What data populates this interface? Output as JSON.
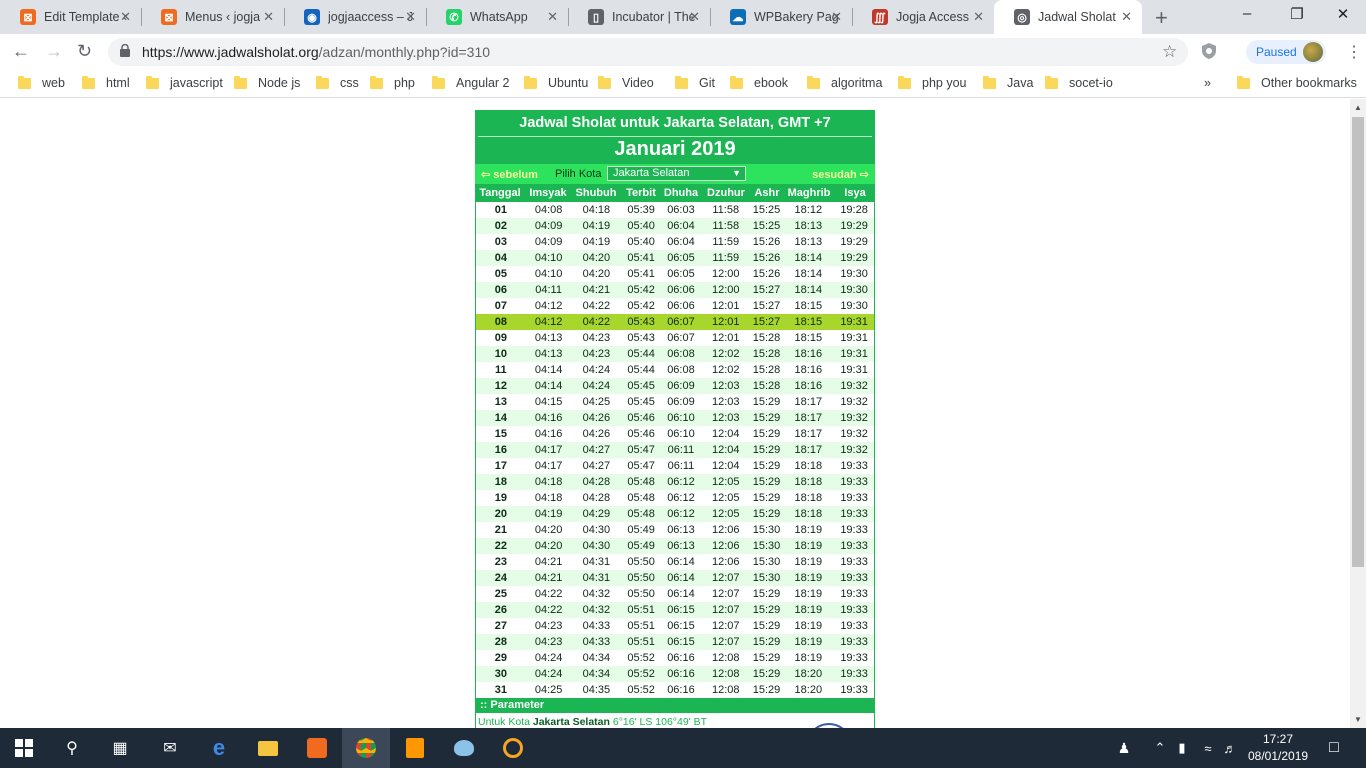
{
  "browser": {
    "tabs": [
      {
        "title": "Edit Template ‹",
        "icon": "xampp-icon",
        "color": "#f06a1f"
      },
      {
        "title": "Menus ‹ jogja",
        "icon": "xampp-icon",
        "color": "#f06a1f"
      },
      {
        "title": "jogjaaccess – J",
        "icon": "vpn-icon",
        "color": "#1565c0"
      },
      {
        "title": "WhatsApp",
        "icon": "whatsapp-icon",
        "color": "#25d366"
      },
      {
        "title": "Incubator | The",
        "icon": "document-icon",
        "color": "#5f6368"
      },
      {
        "title": "WPBakery Pag",
        "icon": "wpbakery-icon",
        "color": "#0d6eb8"
      },
      {
        "title": "Jogja Access",
        "icon": "site-icon",
        "color": "#c0392b"
      },
      {
        "title": "Jadwal Sholat",
        "icon": "globe-icon",
        "color": "#5f6368"
      }
    ],
    "url_host": "https://www.jadwalsholat.org",
    "url_path": "/adzan/monthly.php?id=310",
    "profile_label": "Paused",
    "bookmarks": [
      "web",
      "html",
      "javascript",
      "Node js",
      "css",
      "php",
      "Angular 2",
      "Ubuntu",
      "Video",
      "Git",
      "ebook",
      "algoritma",
      "php you",
      "Java",
      "socet-io"
    ],
    "overflow_label": "»",
    "other_bookmarks": "Other bookmarks"
  },
  "page": {
    "title": "Jadwal Sholat untuk Jakarta Selatan, GMT +7",
    "month": "Januari 2019",
    "prev_label": "sebelum",
    "next_label": "sesudah",
    "city_label": "Pilih Kota",
    "city_value": "Jakarta Selatan",
    "columns": [
      "Tanggal",
      "Imsyak",
      "Shubuh",
      "Terbit",
      "Dhuha",
      "Dzuhur",
      "Ashr",
      "Maghrib",
      "Isya"
    ],
    "highlight_day": "08",
    "rows": [
      [
        "01",
        "04:08",
        "04:18",
        "05:39",
        "06:03",
        "11:58",
        "15:25",
        "18:12",
        "19:28"
      ],
      [
        "02",
        "04:09",
        "04:19",
        "05:40",
        "06:04",
        "11:58",
        "15:25",
        "18:13",
        "19:29"
      ],
      [
        "03",
        "04:09",
        "04:19",
        "05:40",
        "06:04",
        "11:59",
        "15:26",
        "18:13",
        "19:29"
      ],
      [
        "04",
        "04:10",
        "04:20",
        "05:41",
        "06:05",
        "11:59",
        "15:26",
        "18:14",
        "19:29"
      ],
      [
        "05",
        "04:10",
        "04:20",
        "05:41",
        "06:05",
        "12:00",
        "15:26",
        "18:14",
        "19:30"
      ],
      [
        "06",
        "04:11",
        "04:21",
        "05:42",
        "06:06",
        "12:00",
        "15:27",
        "18:14",
        "19:30"
      ],
      [
        "07",
        "04:12",
        "04:22",
        "05:42",
        "06:06",
        "12:01",
        "15:27",
        "18:15",
        "19:30"
      ],
      [
        "08",
        "04:12",
        "04:22",
        "05:43",
        "06:07",
        "12:01",
        "15:27",
        "18:15",
        "19:31"
      ],
      [
        "09",
        "04:13",
        "04:23",
        "05:43",
        "06:07",
        "12:01",
        "15:28",
        "18:15",
        "19:31"
      ],
      [
        "10",
        "04:13",
        "04:23",
        "05:44",
        "06:08",
        "12:02",
        "15:28",
        "18:16",
        "19:31"
      ],
      [
        "11",
        "04:14",
        "04:24",
        "05:44",
        "06:08",
        "12:02",
        "15:28",
        "18:16",
        "19:31"
      ],
      [
        "12",
        "04:14",
        "04:24",
        "05:45",
        "06:09",
        "12:03",
        "15:28",
        "18:16",
        "19:32"
      ],
      [
        "13",
        "04:15",
        "04:25",
        "05:45",
        "06:09",
        "12:03",
        "15:29",
        "18:17",
        "19:32"
      ],
      [
        "14",
        "04:16",
        "04:26",
        "05:46",
        "06:10",
        "12:03",
        "15:29",
        "18:17",
        "19:32"
      ],
      [
        "15",
        "04:16",
        "04:26",
        "05:46",
        "06:10",
        "12:04",
        "15:29",
        "18:17",
        "19:32"
      ],
      [
        "16",
        "04:17",
        "04:27",
        "05:47",
        "06:11",
        "12:04",
        "15:29",
        "18:17",
        "19:32"
      ],
      [
        "17",
        "04:17",
        "04:27",
        "05:47",
        "06:11",
        "12:04",
        "15:29",
        "18:18",
        "19:33"
      ],
      [
        "18",
        "04:18",
        "04:28",
        "05:48",
        "06:12",
        "12:05",
        "15:29",
        "18:18",
        "19:33"
      ],
      [
        "19",
        "04:18",
        "04:28",
        "05:48",
        "06:12",
        "12:05",
        "15:29",
        "18:18",
        "19:33"
      ],
      [
        "20",
        "04:19",
        "04:29",
        "05:48",
        "06:12",
        "12:05",
        "15:29",
        "18:18",
        "19:33"
      ],
      [
        "21",
        "04:20",
        "04:30",
        "05:49",
        "06:13",
        "12:06",
        "15:30",
        "18:19",
        "19:33"
      ],
      [
        "22",
        "04:20",
        "04:30",
        "05:49",
        "06:13",
        "12:06",
        "15:30",
        "18:19",
        "19:33"
      ],
      [
        "23",
        "04:21",
        "04:31",
        "05:50",
        "06:14",
        "12:06",
        "15:30",
        "18:19",
        "19:33"
      ],
      [
        "24",
        "04:21",
        "04:31",
        "05:50",
        "06:14",
        "12:07",
        "15:30",
        "18:19",
        "19:33"
      ],
      [
        "25",
        "04:22",
        "04:32",
        "05:50",
        "06:14",
        "12:07",
        "15:29",
        "18:19",
        "19:33"
      ],
      [
        "26",
        "04:22",
        "04:32",
        "05:51",
        "06:15",
        "12:07",
        "15:29",
        "18:19",
        "19:33"
      ],
      [
        "27",
        "04:23",
        "04:33",
        "05:51",
        "06:15",
        "12:07",
        "15:29",
        "18:19",
        "19:33"
      ],
      [
        "28",
        "04:23",
        "04:33",
        "05:51",
        "06:15",
        "12:07",
        "15:29",
        "18:19",
        "19:33"
      ],
      [
        "29",
        "04:24",
        "04:34",
        "05:52",
        "06:16",
        "12:08",
        "15:29",
        "18:19",
        "19:33"
      ],
      [
        "30",
        "04:24",
        "04:34",
        "05:52",
        "06:16",
        "12:08",
        "15:29",
        "18:20",
        "19:33"
      ],
      [
        "31",
        "04:25",
        "04:35",
        "05:52",
        "06:16",
        "12:08",
        "15:29",
        "18:20",
        "19:33"
      ]
    ],
    "param_header": ":: Parameter",
    "param_prefix": "Untuk Kota",
    "param_city": "Jakarta Selatan",
    "param_coords": "6°16' LS 106°49' BT"
  },
  "taskbar": {
    "time": "17:27",
    "date": "08/01/2019"
  },
  "colors": {
    "accent_green": "#1bb553",
    "nav_green": "#2de35e",
    "row_alt": "#e5fde6",
    "highlight": "#a9d62d"
  }
}
